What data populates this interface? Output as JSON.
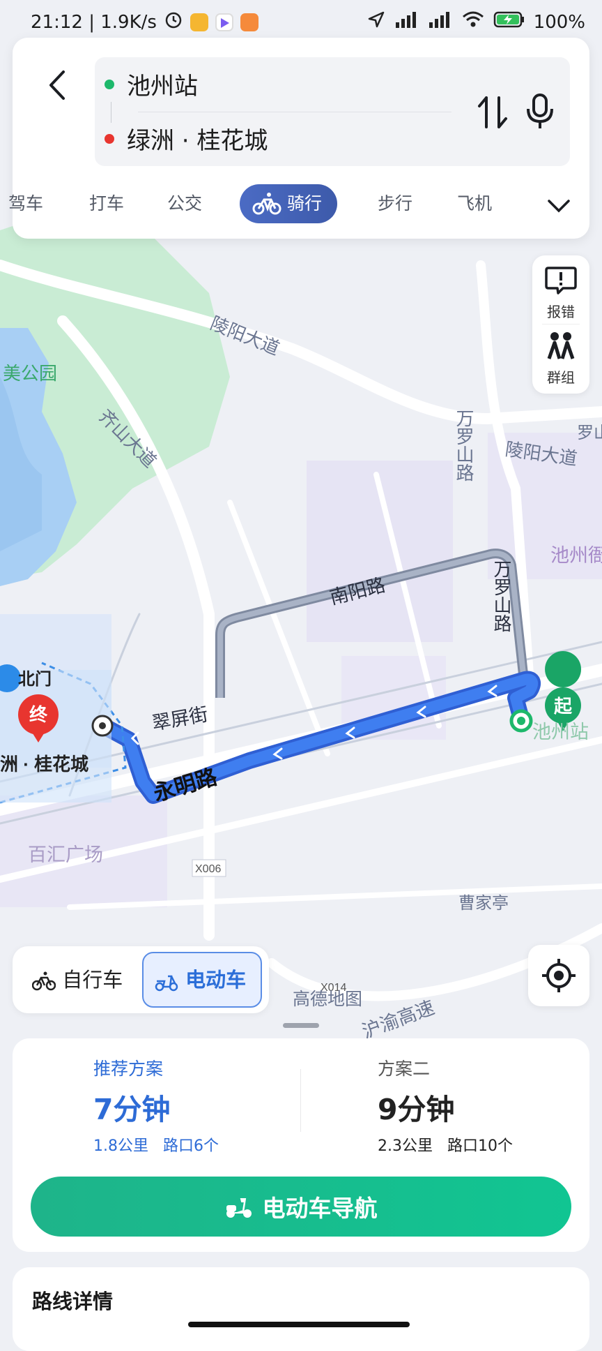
{
  "status_bar": {
    "time_speed": "21:12 | 1.9K/s",
    "battery": "100%",
    "icons": [
      "alarm-icon",
      "app-icon-yellow",
      "app-icon-play",
      "app-icon-orange",
      "location-arrow-icon",
      "signal-hd-icon",
      "signal-hd-icon",
      "wifi-icon",
      "battery-charging-icon"
    ]
  },
  "route": {
    "origin": "池州站",
    "destination": "绿洲 · 桂花城",
    "origin_color": "#1db86b",
    "destination_color": "#e8352f"
  },
  "modes": {
    "items": [
      "驾车",
      "打车",
      "公交",
      "骑行",
      "步行",
      "飞机"
    ],
    "visible_first": "驾车",
    "taxi": "打车",
    "bus": "公交",
    "cycling": "骑行",
    "walking": "步行",
    "plane": "飞机",
    "selected": "骑行"
  },
  "side_tools": {
    "report": "报错",
    "group": "群组"
  },
  "map_labels": {
    "road_lingyang_1": "陵阳大道",
    "road_lingyang_2": "陵阳大道",
    "road_qishan": "齐山大道",
    "road_wanluoshan_1": "万罗山路",
    "road_wanluoshan_2": "万罗山路",
    "road_nanyang": "南阳路",
    "road_cuiping": "翠屏街",
    "road_yongming": "永明路",
    "park": "美公园",
    "poi_luoshan": "罗山",
    "poi_chizhou_edge": "池州衙",
    "poi_station": "池州站",
    "poi_beimen": "北门",
    "poi_dest": "洲 · 桂花城",
    "poi_baihui": "百汇广场",
    "poi_caojiating": "曹家亭",
    "road_x006": "X006",
    "road_x014": "X014",
    "watermark": "高德地图",
    "expressway": "沪渝高速",
    "marker_start": "起",
    "marker_end": "终"
  },
  "vehicle_toggle": {
    "bicycle": "自行车",
    "ebike": "电动车",
    "selected": "电动车"
  },
  "plans": {
    "recommended": {
      "title": "推荐方案",
      "time": "7分钟",
      "desc": "1.8公里   路口6个"
    },
    "second": {
      "title": "方案二",
      "time": "9分钟",
      "desc": "2.3公里   路口10个"
    }
  },
  "navigate_button": "电动车导航",
  "details_title": "路线详情",
  "colors": {
    "route_blue": "#3f7ef0",
    "accent_green": "#14be8f",
    "mode_active": "#3d5aaa"
  }
}
